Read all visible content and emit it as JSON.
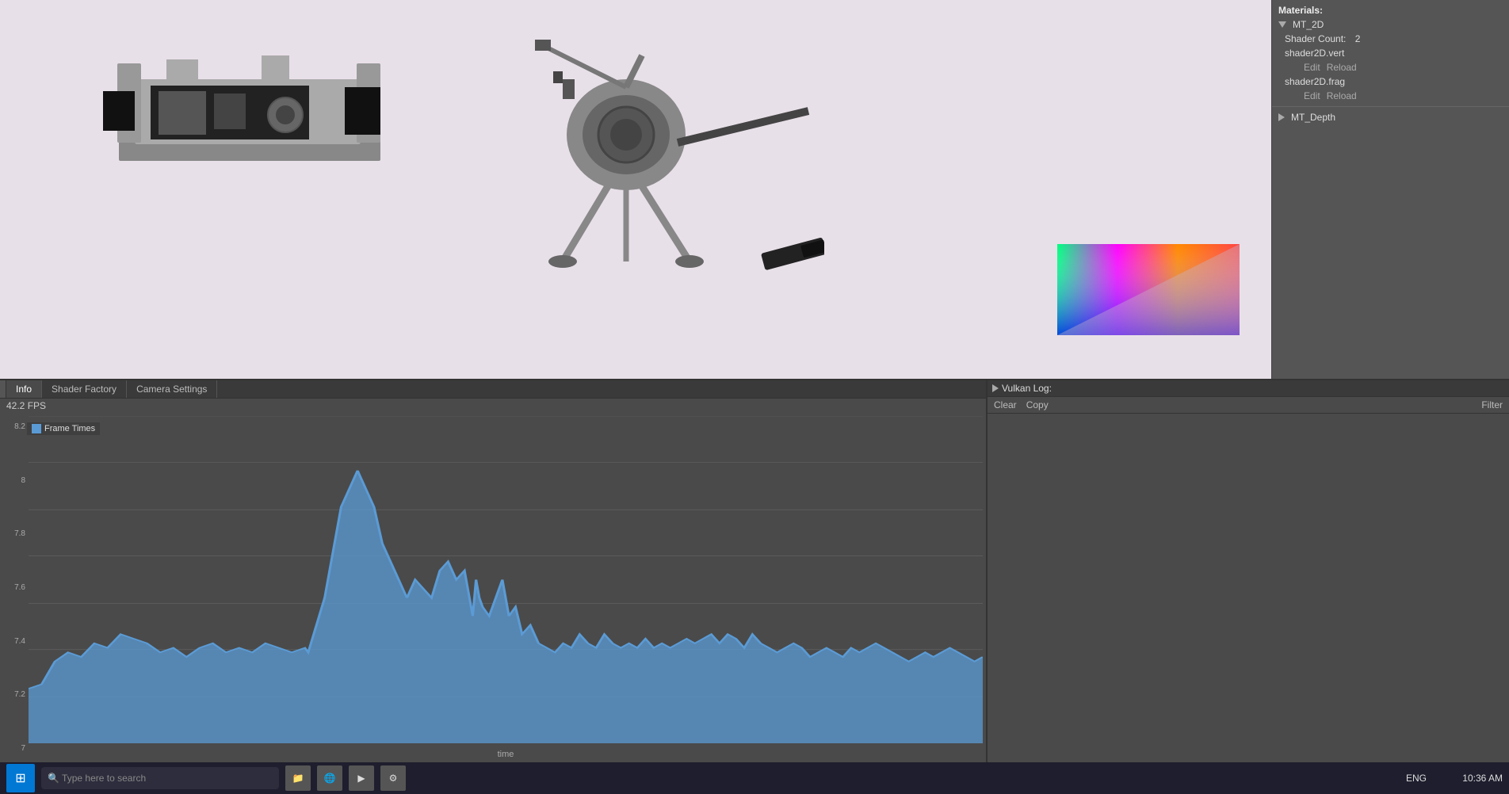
{
  "right_panel": {
    "materials_label": "Materials:",
    "mt2d": {
      "name": "MT_2D",
      "shader_count_label": "Shader Count:",
      "shader_count": "2",
      "vert_file": "shader2D.vert",
      "frag_file": "shader2D.frag",
      "edit_label": "Edit",
      "reload_label": "Reload"
    },
    "mt_depth": {
      "name": "MT_Depth"
    }
  },
  "bottom_tabs": [
    {
      "label": "Info",
      "active": true
    },
    {
      "label": "Shader Factory",
      "active": false
    },
    {
      "label": "Camera Settings",
      "active": false
    }
  ],
  "fps": "42.2 FPS",
  "chart": {
    "legend": "Frame Times",
    "x_label": "time",
    "y_labels": [
      "8.2",
      "8",
      "7.8",
      "7.6",
      "7.4",
      "7.2",
      "7"
    ]
  },
  "log": {
    "title": "Vulkan Log:",
    "clear_label": "Clear",
    "copy_label": "Copy",
    "filter_label": "Filter"
  },
  "taskbar": {
    "locale": "ENG",
    "time": "10:36 AM"
  }
}
